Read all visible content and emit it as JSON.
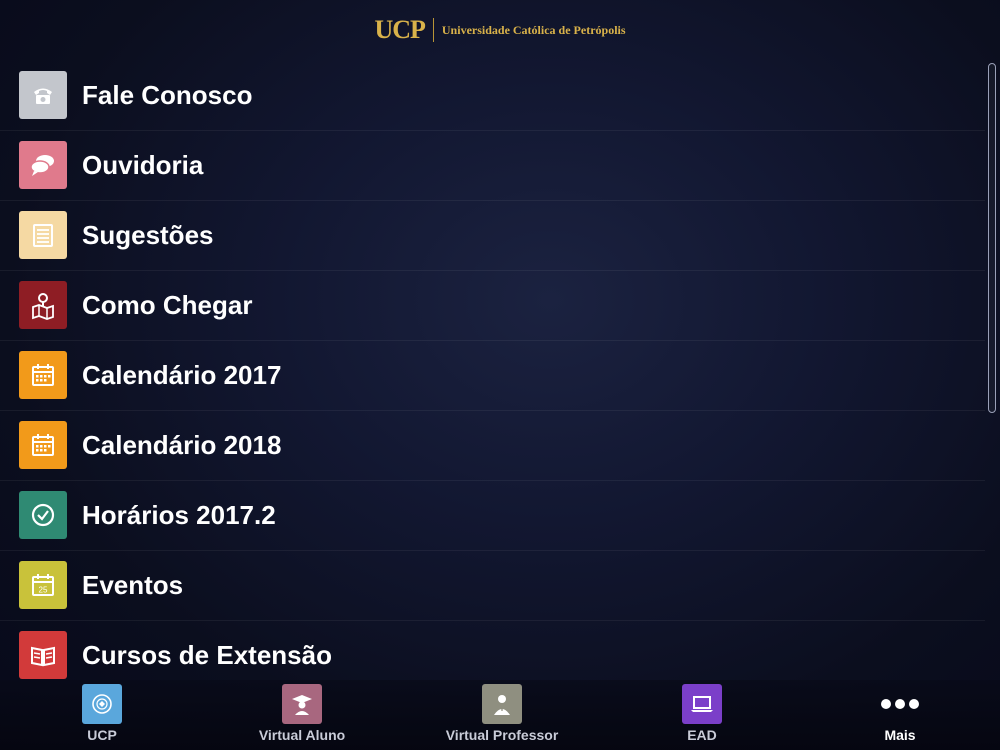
{
  "header": {
    "logo_mark": "UCP",
    "logo_text": "Universidade Católica de Petrópolis"
  },
  "menu": {
    "items": [
      {
        "label": "Fale Conosco",
        "icon": "telephone-icon",
        "color": "#c3c6cc"
      },
      {
        "label": "Ouvidoria",
        "icon": "speech-bubbles-icon",
        "color": "#e07a8c"
      },
      {
        "label": "Sugestões",
        "icon": "notepad-icon",
        "color": "#f5d9a3"
      },
      {
        "label": "Como Chegar",
        "icon": "map-pin-icon",
        "color": "#8e1d24"
      },
      {
        "label": "Calendário 2017",
        "icon": "calendar-icon",
        "color": "#f29a1a"
      },
      {
        "label": "Calendário 2018",
        "icon": "calendar-icon",
        "color": "#f29a1a"
      },
      {
        "label": "Horários 2017.2",
        "icon": "clock-icon",
        "color": "#2f8a73"
      },
      {
        "label": "Eventos",
        "icon": "calendar-day-icon",
        "color": "#c9c23a",
        "day": "25"
      },
      {
        "label": "Cursos de Extensão",
        "icon": "open-book-icon",
        "color": "#d23a3a"
      }
    ]
  },
  "tabbar": {
    "tabs": [
      {
        "label": "UCP",
        "icon": "university-seal-icon",
        "color": "#5aa7dc"
      },
      {
        "label": "Virtual Aluno",
        "icon": "graduate-icon",
        "color": "#a8677f"
      },
      {
        "label": "Virtual Professor",
        "icon": "professor-icon",
        "color": "#8f8f80"
      },
      {
        "label": "EAD",
        "icon": "laptop-icon",
        "color": "#7b3fc9"
      },
      {
        "label": "Mais",
        "icon": "more-dots-icon",
        "color": "#ffffff"
      }
    ]
  }
}
